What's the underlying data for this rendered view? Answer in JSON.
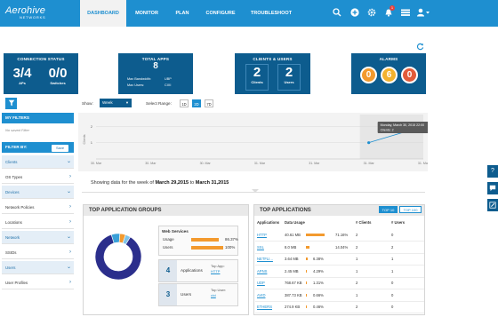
{
  "brand": {
    "name": "Aerohive",
    "sub": "NETWORKS"
  },
  "nav": {
    "tabs": [
      "DASHBOARD",
      "MONITOR",
      "PLAN",
      "CONFIGURE",
      "TROUBLESHOOT"
    ],
    "active": "DASHBOARD"
  },
  "header_icons": [
    "search-icon",
    "plus-icon",
    "gear-icon",
    "bell-icon",
    "list-icon",
    "user-icon"
  ],
  "notifications": {
    "count": "1"
  },
  "tiles": {
    "connection": {
      "title": "CONNECTION STATUS",
      "aps_value": "3/4",
      "aps_label": "APs",
      "switches_value": "0/0",
      "switches_label": "Switches"
    },
    "apps": {
      "title": "TOTAL APPS",
      "value": "8",
      "bw_label": "Max Bandwidth:",
      "bw_value": "UBP",
      "users_label": "Max Users:",
      "users_value": "CIXI"
    },
    "clients": {
      "title": "CLIENTS & USERS",
      "clients_value": "2",
      "clients_label": "Clients",
      "users_value": "2",
      "users_label": "Users"
    },
    "alarms": {
      "title": "ALARMS",
      "values": [
        "0",
        "6",
        "0"
      ],
      "colors": [
        "#f39a2e",
        "#f3b22e",
        "#e25b3a"
      ]
    }
  },
  "sidebar": {
    "my_filters": "MY FILTERS",
    "no_saved": "No saved Filter",
    "filter_by": "FILTER BY:",
    "save": "Save",
    "items": [
      "Clients",
      "OS Types",
      "Devices",
      "Network Policies",
      "Locations",
      "Network",
      "SSIDs",
      "Users",
      "User Profiles"
    ]
  },
  "chart_controls": {
    "show_label": "Show:",
    "show_value": "Week",
    "range_label": "Select Range:",
    "ranges": [
      "1D",
      "2D",
      "7D"
    ],
    "active_range": "2D"
  },
  "chart_data": {
    "type": "line",
    "x": [
      "30. Mar",
      "30. Mar",
      "30. Mar",
      "31. Mar",
      "31. Mar",
      "31. Mar",
      "31. Mar"
    ],
    "series": [
      {
        "values": [
          null,
          null,
          null,
          null,
          null,
          1,
          2
        ]
      }
    ],
    "ylabel": "Clients",
    "yticks": [
      "1",
      "2"
    ],
    "tooltip": {
      "title": "Monday, March 30, 2015 22:00",
      "label": "Clients:",
      "value": "2"
    }
  },
  "showing": {
    "prefix": "Showing data for the week of",
    "from": "March 29,2015",
    "mid": "to",
    "to": "March 31,2015"
  },
  "groups": {
    "title": "TOP APPLICATION GROUPS",
    "donut": [
      {
        "value": 86.37,
        "color": "#2b2e8c"
      },
      {
        "value": 6,
        "color": "#3aa0d8"
      },
      {
        "value": 4,
        "color": "#f39a2e"
      },
      {
        "value": 3.63,
        "color": "#7fc3e8"
      }
    ],
    "web_services": {
      "title": "Web Services",
      "usage_label": "Usage",
      "usage_value": "86.37%",
      "usage_pct": 86.37,
      "users_label": "Users",
      "users_value": "100%",
      "users_pct": 100
    },
    "apps_stat": {
      "value": "4",
      "label": "Applications",
      "sub_label": "Top App:",
      "sub_value": "HTTP"
    },
    "users_stat": {
      "value": "3",
      "label": "Users",
      "sub_label": "Top User:",
      "sub_value": "cixi"
    }
  },
  "top_apps": {
    "title": "TOP APPLICATIONS",
    "buttons": [
      "TOP 10",
      "TOP 100"
    ],
    "headers": [
      "Applications",
      "Data Usage",
      "# Clients",
      "# Users"
    ],
    "rows": [
      {
        "app": "HTTP",
        "usage": "40.61 MB",
        "pct": "71.16%",
        "pct_value": 71.16,
        "clients": "2",
        "users": "0"
      },
      {
        "app": "SSL",
        "usage": "8.0 MB",
        "pct": "14.04%",
        "pct_value": 14.04,
        "clients": "2",
        "users": "2"
      },
      {
        "app": "NETFLI...",
        "usage": "3.64 MB",
        "pct": "6.38%",
        "pct_value": 6.38,
        "clients": "1",
        "users": "1"
      },
      {
        "app": "APNS",
        "usage": "2.45 MB",
        "pct": "4.29%",
        "pct_value": 4.29,
        "clients": "1",
        "users": "1"
      },
      {
        "app": "UDP",
        "usage": "768.67 KB",
        "pct": "1.31%",
        "pct_value": 1.31,
        "clients": "2",
        "users": "0"
      },
      {
        "app": "AVID",
        "usage": "387.73 KB",
        "pct": "0.66%",
        "pct_value": 0.66,
        "clients": "1",
        "users": "0"
      },
      {
        "app": "ETHERS",
        "usage": "274.9 KB",
        "pct": "0.46%",
        "pct_value": 0.46,
        "clients": "2",
        "users": "0"
      }
    ]
  }
}
